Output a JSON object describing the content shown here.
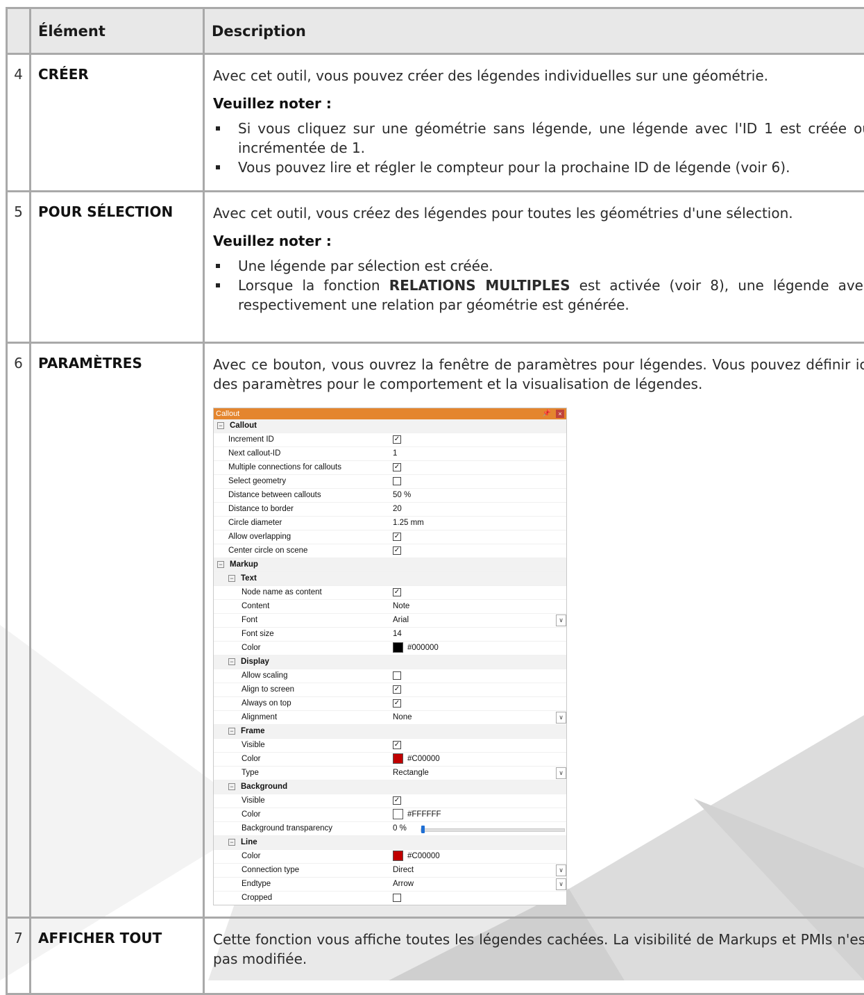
{
  "header": {
    "col_element": "Élément",
    "col_description": "Description"
  },
  "rows": [
    {
      "num": "4",
      "element": "CRÉER",
      "desc": "Avec cet outil, vous pouvez créer des légendes individuelles sur une géométrie.",
      "note": "Veuillez noter :",
      "bullets": [
        "Si vous cliquez sur une géométrie sans légende, une légende avec l'ID 1 est créée ou incrémentée de 1.",
        "Vous pouvez lire et régler le compteur pour la prochaine ID de légende (voir 6)."
      ]
    },
    {
      "num": "5",
      "element": "POUR SÉLECTION",
      "desc": "Avec cet outil, vous créez des légendes pour toutes les géométries d'une sélection.",
      "note": "Veuillez noter :",
      "bullet1": "Une légende par sélection est créée.",
      "bullet2_pre": "Lorsque la fonction ",
      "bullet2_bold": "RELATIONS MULTIPLES",
      "bullet2_post": " est activée (voir 8), une légende avec respectivement une relation par géométrie est générée."
    },
    {
      "num": "6",
      "element": "PARAMÈTRES",
      "desc": "Avec ce bouton, vous ouvrez la fenêtre de paramètres pour légendes. Vous pouvez définir ici des paramètres pour le comportement et la visualisation de légendes."
    },
    {
      "num": "7",
      "element": "AFFICHER TOUT",
      "desc": "Cette fonction vous affiche toutes les légendes cachées. La visibilité de Markups et PMIs n'est pas modifiée."
    }
  ],
  "panel": {
    "title": "Callout",
    "pin_icon": "pin-icon",
    "close_icon": "close-icon",
    "groups": {
      "callout": "Callout",
      "markup": "Markup",
      "text": "Text",
      "display": "Display",
      "frame": "Frame",
      "background": "Background",
      "line": "Line"
    },
    "props": {
      "increment_id": {
        "name": "Increment ID",
        "checked": true
      },
      "next_id": {
        "name": "Next callout-ID",
        "value": "1"
      },
      "multi_conn": {
        "name": "Multiple connections for callouts",
        "checked": true
      },
      "select_geom": {
        "name": "Select geometry",
        "checked": false
      },
      "dist_between": {
        "name": "Distance between callouts",
        "value": "50 %"
      },
      "dist_border": {
        "name": "Distance to border",
        "value": "20"
      },
      "circle_diam": {
        "name": "Circle diameter",
        "value": "1.25 mm"
      },
      "allow_overlap": {
        "name": "Allow overlapping",
        "checked": true
      },
      "center_circle": {
        "name": "Center circle on scene",
        "checked": true
      },
      "node_name": {
        "name": "Node name as content",
        "checked": true
      },
      "content": {
        "name": "Content",
        "value": "Note"
      },
      "font": {
        "name": "Font",
        "value": "Arial"
      },
      "font_size": {
        "name": "Font size",
        "value": "14"
      },
      "text_color": {
        "name": "Color",
        "value": "#000000",
        "swatch": "#000000"
      },
      "allow_scaling": {
        "name": "Allow scaling",
        "checked": false
      },
      "align_screen": {
        "name": "Align to screen",
        "checked": true
      },
      "always_top": {
        "name": "Always on top",
        "checked": true
      },
      "alignment": {
        "name": "Alignment",
        "value": "None"
      },
      "frame_visible": {
        "name": "Visible",
        "checked": true
      },
      "frame_color": {
        "name": "Color",
        "value": "#C00000",
        "swatch": "#C00000"
      },
      "frame_type": {
        "name": "Type",
        "value": "Rectangle"
      },
      "bg_visible": {
        "name": "Visible",
        "checked": true
      },
      "bg_color": {
        "name": "Color",
        "value": "#FFFFFF",
        "swatch": "#FFFFFF"
      },
      "bg_transp": {
        "name": "Background transparency",
        "value": "0 %",
        "level": 0
      },
      "line_color": {
        "name": "Color",
        "value": "#C00000",
        "swatch": "#C00000"
      },
      "conn_type": {
        "name": "Connection type",
        "value": "Direct"
      },
      "endtype": {
        "name": "Endtype",
        "value": "Arrow"
      },
      "cropped": {
        "name": "Cropped",
        "checked": false
      }
    }
  }
}
